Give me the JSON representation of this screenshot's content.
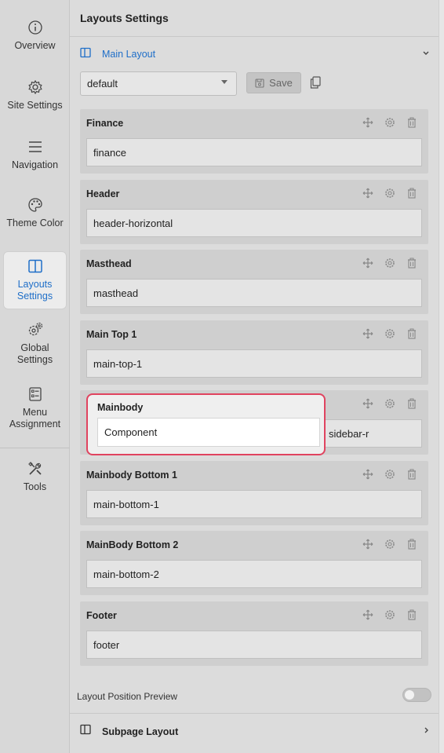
{
  "sidebar": {
    "items": [
      {
        "label": "Overview",
        "icon": "info-icon"
      },
      {
        "label": "Site Settings",
        "icon": "gear-icon"
      },
      {
        "label": "Navigation",
        "icon": "menu-icon"
      },
      {
        "label": "Theme Color",
        "icon": "palette-icon"
      },
      {
        "label": "Layouts Settings",
        "icon": "layout-icon",
        "active": true
      },
      {
        "label": "Global Settings",
        "icon": "gears-icon"
      },
      {
        "label": "Menu Assignment",
        "icon": "list-icon"
      },
      {
        "label": "Tools",
        "icon": "tools-icon"
      }
    ]
  },
  "panel": {
    "title": "Layouts Settings",
    "main_layout": {
      "title": "Main Layout",
      "selected_layout": "default",
      "save_label": "Save"
    },
    "rows": [
      {
        "title": "Finance",
        "value": "finance"
      },
      {
        "title": "Header",
        "value": "header-horizontal"
      },
      {
        "title": "Masthead",
        "value": "masthead"
      },
      {
        "title": "Main Top 1",
        "value": "main-top-1"
      },
      {
        "title": "Mainbody",
        "value": "Component",
        "side_value": "sidebar-r"
      },
      {
        "title": "Mainbody Bottom 1",
        "value": "main-bottom-1"
      },
      {
        "title": "MainBody Bottom 2",
        "value": "main-bottom-2"
      },
      {
        "title": "Footer",
        "value": "footer"
      }
    ],
    "preview_label": "Layout Position Preview",
    "preview_enabled": false,
    "subpage_layout_title": "Subpage Layout"
  },
  "colors": {
    "accent": "#1e6ec8",
    "highlight": "#e0435f"
  }
}
